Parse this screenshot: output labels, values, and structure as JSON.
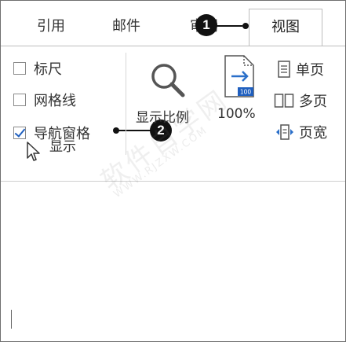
{
  "tabs": [
    {
      "label": "引用"
    },
    {
      "label": "邮件"
    },
    {
      "label": "审阅"
    },
    {
      "label": "视图",
      "active": true
    }
  ],
  "show_group": {
    "label": "显示",
    "items": [
      {
        "label": "标尺",
        "checked": false
      },
      {
        "label": "网格线",
        "checked": false
      },
      {
        "label": "导航窗格",
        "checked": true
      }
    ]
  },
  "zoom_group": {
    "zoom_label": "显示比例",
    "percent_label": "100%",
    "percent_badge": "100"
  },
  "view_items": [
    {
      "label": "单页",
      "icon": "single-page-icon"
    },
    {
      "label": "多页",
      "icon": "multi-page-icon"
    },
    {
      "label": "页宽",
      "icon": "page-width-icon"
    }
  ],
  "callouts": [
    {
      "number": "1"
    },
    {
      "number": "2"
    }
  ],
  "watermark": {
    "text": "软件自学网",
    "sub": "WWW.RJZXW.COM"
  },
  "colors": {
    "accent": "#1f5fbf",
    "callout": "#111111",
    "border": "#bdbdbd"
  }
}
